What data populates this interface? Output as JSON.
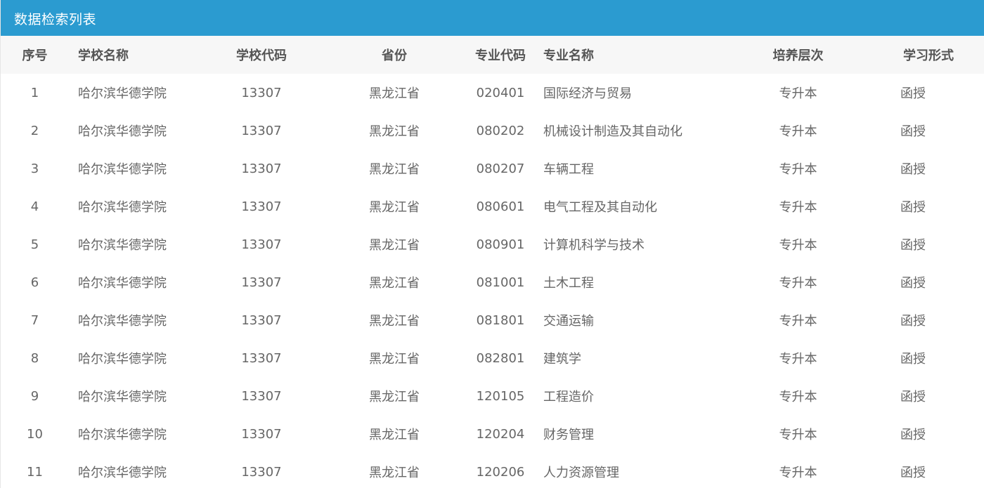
{
  "panel": {
    "title": "数据检索列表"
  },
  "table": {
    "headers": {
      "index": "序号",
      "school_name": "学校名称",
      "school_code": "学校代码",
      "province": "省份",
      "major_code": "专业代码",
      "major_name": "专业名称",
      "level": "培养层次",
      "study_form": "学习形式"
    },
    "rows": [
      {
        "index": "1",
        "school_name": "哈尔滨华德学院",
        "school_code": "13307",
        "province": "黑龙江省",
        "major_code": "020401",
        "major_name": "国际经济与贸易",
        "level": "专升本",
        "study_form": "函授"
      },
      {
        "index": "2",
        "school_name": "哈尔滨华德学院",
        "school_code": "13307",
        "province": "黑龙江省",
        "major_code": "080202",
        "major_name": "机械设计制造及其自动化",
        "level": "专升本",
        "study_form": "函授"
      },
      {
        "index": "3",
        "school_name": "哈尔滨华德学院",
        "school_code": "13307",
        "province": "黑龙江省",
        "major_code": "080207",
        "major_name": "车辆工程",
        "level": "专升本",
        "study_form": "函授"
      },
      {
        "index": "4",
        "school_name": "哈尔滨华德学院",
        "school_code": "13307",
        "province": "黑龙江省",
        "major_code": "080601",
        "major_name": "电气工程及其自动化",
        "level": "专升本",
        "study_form": "函授"
      },
      {
        "index": "5",
        "school_name": "哈尔滨华德学院",
        "school_code": "13307",
        "province": "黑龙江省",
        "major_code": "080901",
        "major_name": "计算机科学与技术",
        "level": "专升本",
        "study_form": "函授"
      },
      {
        "index": "6",
        "school_name": "哈尔滨华德学院",
        "school_code": "13307",
        "province": "黑龙江省",
        "major_code": "081001",
        "major_name": "土木工程",
        "level": "专升本",
        "study_form": "函授"
      },
      {
        "index": "7",
        "school_name": "哈尔滨华德学院",
        "school_code": "13307",
        "province": "黑龙江省",
        "major_code": "081801",
        "major_name": "交通运输",
        "level": "专升本",
        "study_form": "函授"
      },
      {
        "index": "8",
        "school_name": "哈尔滨华德学院",
        "school_code": "13307",
        "province": "黑龙江省",
        "major_code": "082801",
        "major_name": "建筑学",
        "level": "专升本",
        "study_form": "函授"
      },
      {
        "index": "9",
        "school_name": "哈尔滨华德学院",
        "school_code": "13307",
        "province": "黑龙江省",
        "major_code": "120105",
        "major_name": "工程造价",
        "level": "专升本",
        "study_form": "函授"
      },
      {
        "index": "10",
        "school_name": "哈尔滨华德学院",
        "school_code": "13307",
        "province": "黑龙江省",
        "major_code": "120204",
        "major_name": "财务管理",
        "level": "专升本",
        "study_form": "函授"
      },
      {
        "index": "11",
        "school_name": "哈尔滨华德学院",
        "school_code": "13307",
        "province": "黑龙江省",
        "major_code": "120206",
        "major_name": "人力资源管理",
        "level": "专升本",
        "study_form": "函授"
      }
    ]
  },
  "colors": {
    "header_bar": "#2b9bd0",
    "table_head_bg": "#f7f7f7",
    "head_text": "#555555",
    "cell_text": "#666666"
  }
}
